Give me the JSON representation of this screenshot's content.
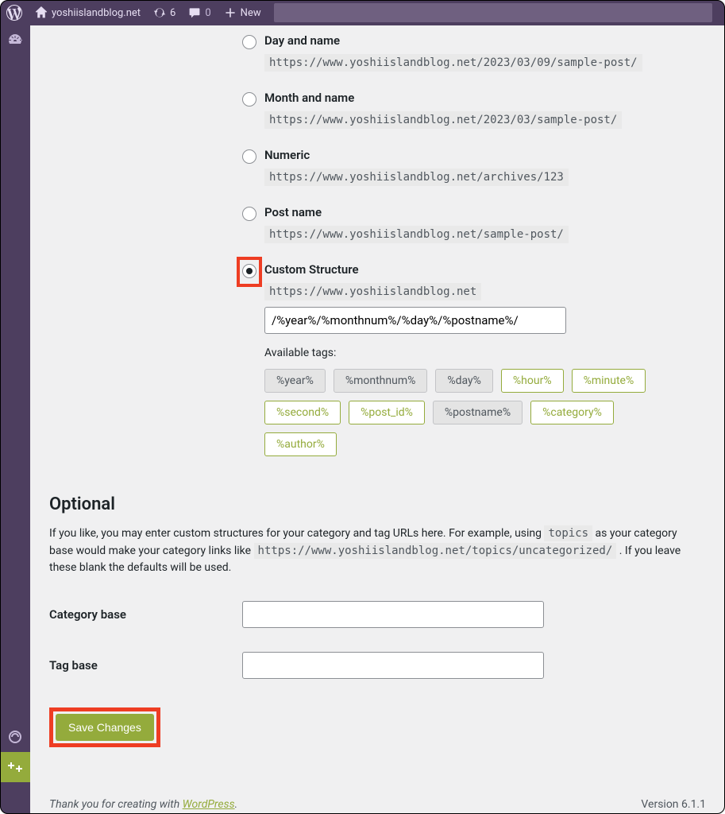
{
  "adminbar": {
    "site_name": "yoshiislandblog.net",
    "updates_count": "6",
    "comments_count": "0",
    "new_label": "New"
  },
  "permalink_options": [
    {
      "label": "Day and name",
      "example": "https://www.yoshiislandblog.net/2023/03/09/sample-post/",
      "checked": false
    },
    {
      "label": "Month and name",
      "example": "https://www.yoshiislandblog.net/2023/03/sample-post/",
      "checked": false
    },
    {
      "label": "Numeric",
      "example": "https://www.yoshiislandblog.net/archives/123",
      "checked": false
    },
    {
      "label": "Post name",
      "example": "https://www.yoshiislandblog.net/sample-post/",
      "checked": false
    }
  ],
  "custom": {
    "label": "Custom Structure",
    "base_url": "https://www.yoshiislandblog.net",
    "value": "/%year%/%monthnum%/%day%/%postname%/",
    "available_label": "Available tags:",
    "tags": [
      {
        "text": "%year%",
        "active": true
      },
      {
        "text": "%monthnum%",
        "active": true
      },
      {
        "text": "%day%",
        "active": true
      },
      {
        "text": "%hour%",
        "active": false
      },
      {
        "text": "%minute%",
        "active": false
      },
      {
        "text": "%second%",
        "active": false
      },
      {
        "text": "%post_id%",
        "active": false
      },
      {
        "text": "%postname%",
        "active": true
      },
      {
        "text": "%category%",
        "active": false
      },
      {
        "text": "%author%",
        "active": false
      }
    ]
  },
  "optional": {
    "heading": "Optional",
    "desc_1": "If you like, you may enter custom structures for your category and tag URLs here. For example, using ",
    "desc_code1": "topics",
    "desc_2": " as your category base would make your category links like ",
    "desc_code2": "https://www.yoshiislandblog.net/topics/uncategorized/",
    "desc_3": " . If you leave these blank the defaults will be used.",
    "category_label": "Category base",
    "category_value": "",
    "tag_label": "Tag base",
    "tag_value": ""
  },
  "submit_label": "Save Changes",
  "footer": {
    "thanks_1": "Thank you for creating with ",
    "thanks_link": "WordPress",
    "thanks_2": ".",
    "version": "Version 6.1.1"
  }
}
